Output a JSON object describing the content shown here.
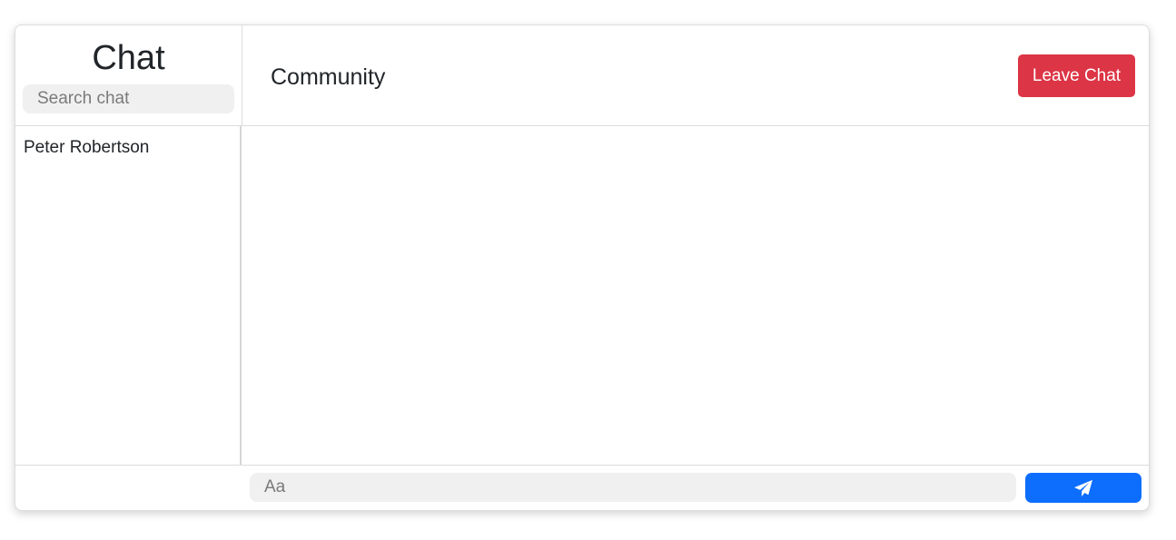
{
  "sidebar": {
    "title": "Chat",
    "search_placeholder": "Search chat",
    "contacts": [
      {
        "name": "Peter Robertson"
      }
    ]
  },
  "header": {
    "room_title": "Community",
    "leave_label": "Leave Chat"
  },
  "composer": {
    "placeholder": "Aa",
    "send_icon": "paper-plane-icon"
  },
  "colors": {
    "danger": "#dc3545",
    "primary": "#0d6efd",
    "input_background": "#f0f0f0"
  }
}
